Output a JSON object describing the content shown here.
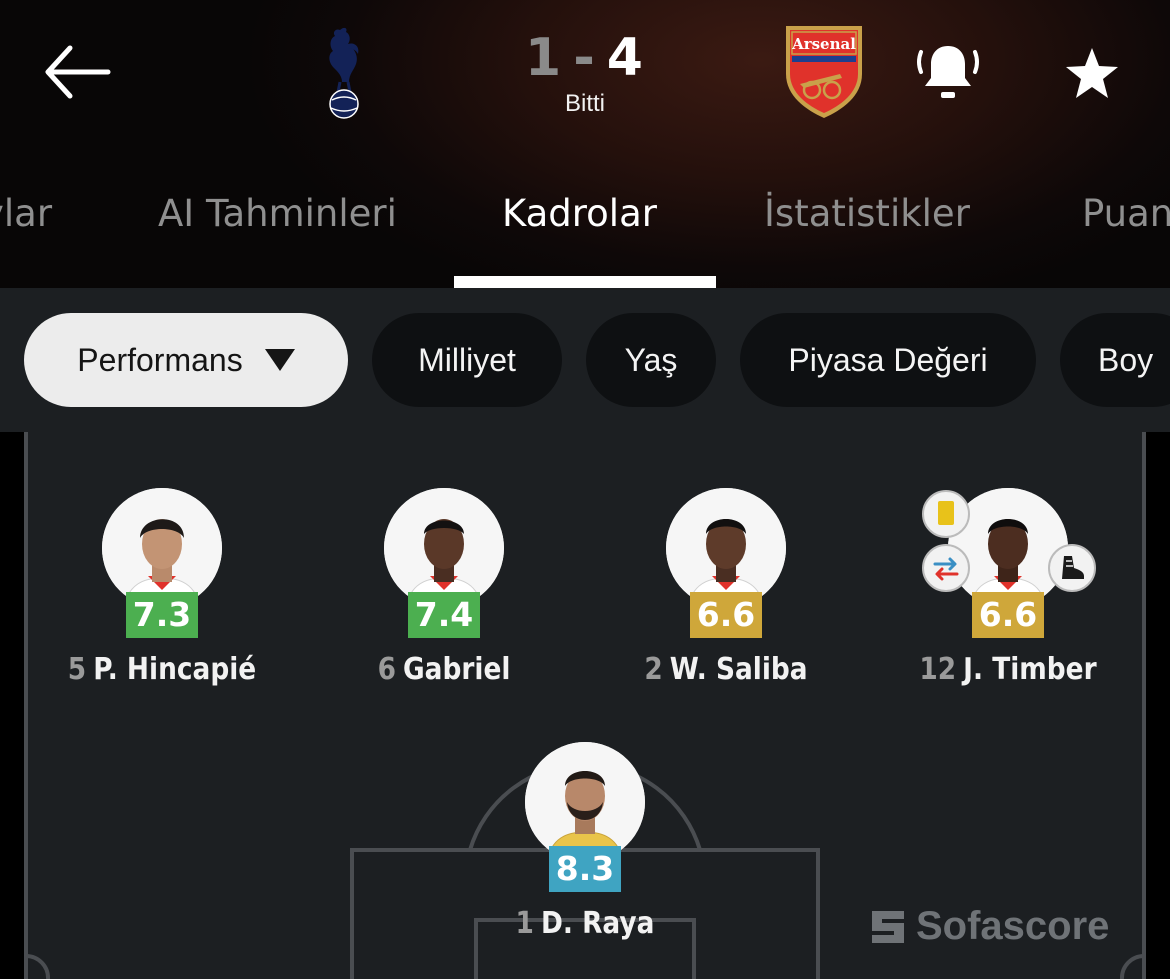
{
  "match": {
    "home_score": "1",
    "separator": "-",
    "away_score": "4",
    "status": "Bitti",
    "away_team_logo_text": "Arsenal"
  },
  "tabs": [
    {
      "label": "ylar",
      "active": false
    },
    {
      "label": "AI Tahminleri",
      "active": false
    },
    {
      "label": "Kadrolar",
      "active": true
    },
    {
      "label": "İstatistikler",
      "active": false
    },
    {
      "label": "Puan",
      "active": false
    }
  ],
  "filters": [
    {
      "label": "Performans",
      "active": true
    },
    {
      "label": "Milliyet",
      "active": false
    },
    {
      "label": "Yaş",
      "active": false
    },
    {
      "label": "Piyasa Değeri",
      "active": false
    },
    {
      "label": "Boy",
      "active": false
    }
  ],
  "players": [
    {
      "number": "5",
      "name": "P. Hincapié",
      "rating": "7.3",
      "rating_color": "#4caf50"
    },
    {
      "number": "6",
      "name": "Gabriel",
      "rating": "7.4",
      "rating_color": "#4caf50"
    },
    {
      "number": "2",
      "name": "W. Saliba",
      "rating": "6.6",
      "rating_color": "#cfa73a"
    },
    {
      "number": "12",
      "name": "J. Timber",
      "rating": "6.6",
      "rating_color": "#cfa73a"
    },
    {
      "number": "1",
      "name": "D. Raya",
      "rating": "8.3",
      "rating_color": "#3fa4c2"
    }
  ],
  "watermark": "Sofascore",
  "icons": {
    "back": "arrow-left-icon",
    "bell": "bell-icon",
    "star": "star-icon",
    "yellow_card": "yellow-card-icon",
    "substitution": "substitution-icon",
    "boot": "boot-icon",
    "dropdown": "caret-down-icon"
  },
  "colors": {
    "accent": "#ffffff",
    "chip_active": "#ececec",
    "chip_inactive": "#0e1012",
    "pitch_line": "#4a4d51",
    "arsenal_red": "#e0322b",
    "spurs_navy": "#132257"
  }
}
